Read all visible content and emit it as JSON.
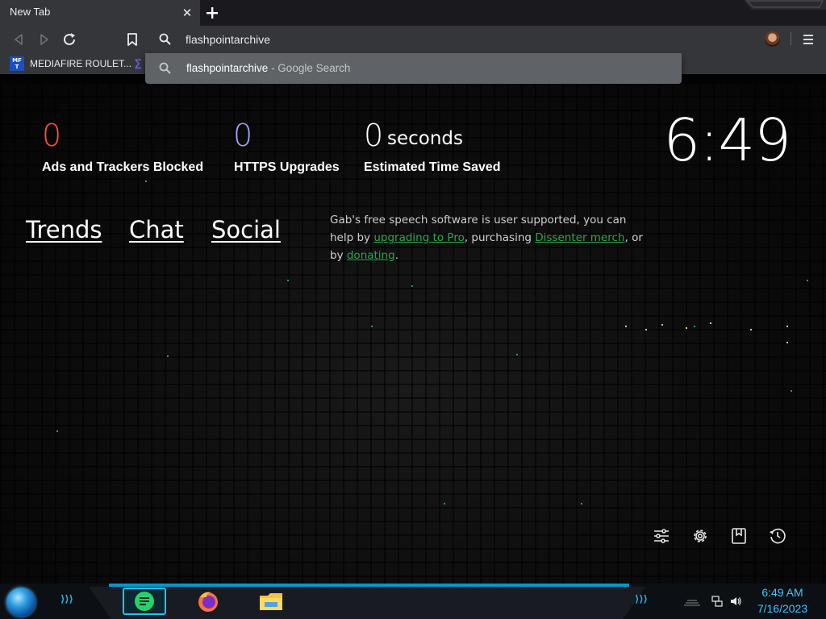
{
  "tabs": [
    {
      "title": "New Tab",
      "active": true
    }
  ],
  "omnibox": {
    "value": "flashpointarchive"
  },
  "bookmarks": [
    {
      "label": "MEDIAFIRE ROULET..."
    }
  ],
  "suggestion": {
    "query": "flashpointarchive",
    "suffix": " - Google Search"
  },
  "stats": {
    "ads": {
      "value": "0",
      "label": "Ads and Trackers Blocked",
      "color": "#ff5033"
    },
    "https": {
      "value": "0",
      "label": "HTTPS Upgrades",
      "color": "#a3a0f5"
    },
    "time": {
      "value": "0",
      "unit": "seconds",
      "label": "Estimated Time Saved"
    }
  },
  "clock": "6:49",
  "links": [
    "Trends",
    "Chat",
    "Social"
  ],
  "gab_message": {
    "t1": "Gab's free speech software is user supported, you can help by ",
    "link1": "upgrading to Pro",
    "t2": ", purchasing ",
    "link2": "Dissenter merch",
    "t3": ", or by ",
    "link3": "donating",
    "t4": "."
  },
  "taskbar": {
    "time": "6:49 AM",
    "date": "7/16/2023"
  },
  "icons": {
    "ntp": [
      "customize-icon",
      "settings-icon",
      "bookmarks-icon",
      "history-icon"
    ],
    "taskbar": [
      "start-orb-icon",
      "chat-app-icon",
      "firefox-icon",
      "file-explorer-icon"
    ],
    "tray": [
      "network-icon",
      "volume-icon"
    ]
  },
  "accent_color": "#1ec3ff"
}
